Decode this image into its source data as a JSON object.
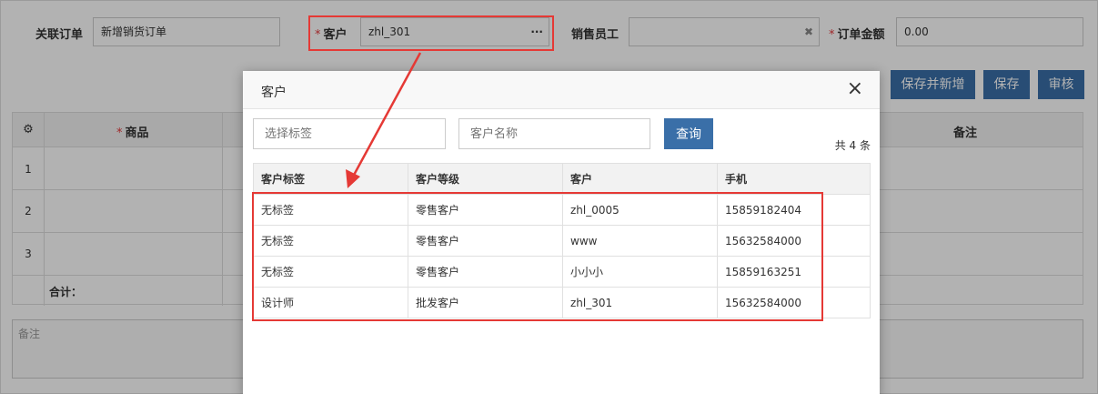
{
  "form": {
    "related_order_label": "关联订单",
    "related_order_value": "新增销货订单",
    "customer_label": "客户",
    "customer_value": "zhl_301",
    "customer_picker_glyph": "···",
    "sales_staff_label": "销售员工",
    "sales_staff_value": "",
    "clear_glyph": "✖",
    "order_amount_label": "订单金额",
    "order_amount_value": "0.00",
    "required_mark": "*"
  },
  "toolbar": {
    "save_and_new": "保存并新增",
    "save": "保存",
    "review": "审核"
  },
  "grid": {
    "settings_glyph": "⚙",
    "product_header": "商品",
    "remark_header": "备注",
    "row_numbers": [
      "1",
      "2",
      "3"
    ],
    "total_label": "合计："
  },
  "remark_box": {
    "placeholder": "备注"
  },
  "modal": {
    "title": "客户",
    "close_glyph": "×",
    "tag_placeholder": "选择标签",
    "name_placeholder": "客户名称",
    "query_label": "查询",
    "total_count": "共 4 条",
    "columns": [
      "客户标签",
      "客户等级",
      "客户",
      "手机"
    ],
    "rows": [
      [
        "无标签",
        "零售客户",
        "zhl_0005",
        "15859182404"
      ],
      [
        "无标签",
        "零售客户",
        "www",
        "15632584000"
      ],
      [
        "无标签",
        "零售客户",
        "小小小",
        "15859163251"
      ],
      [
        "设计师",
        "批发客户",
        "zhl_301",
        "15632584000"
      ]
    ]
  },
  "colors": {
    "primary": "#3a6fa8",
    "highlight": "#e53935"
  }
}
